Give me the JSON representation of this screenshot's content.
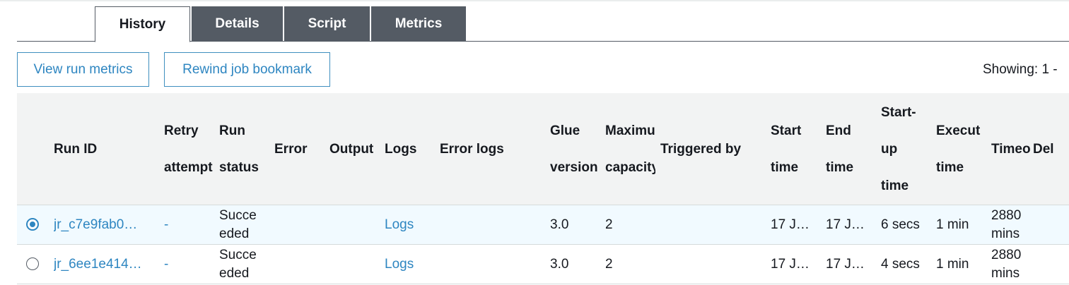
{
  "tabs": [
    {
      "label": "History",
      "active": true
    },
    {
      "label": "Details",
      "active": false
    },
    {
      "label": "Script",
      "active": false
    },
    {
      "label": "Metrics",
      "active": false
    }
  ],
  "actions": {
    "view_run_metrics": "View run metrics",
    "rewind_job_bookmark": "Rewind job bookmark",
    "showing": "Showing: 1 -"
  },
  "columns": {
    "run_id": "Run ID",
    "retry_attempt_1": "Retry",
    "retry_attempt_2": "attempt",
    "run_status_1": "Run",
    "run_status_2": "status",
    "error": "Error",
    "output": "Output",
    "logs": "Logs",
    "error_logs": "Error logs",
    "glue_version_1": "Glue",
    "glue_version_2": "version",
    "maximum_capacity_1": "Maximum",
    "maximum_capacity_2": "capacity",
    "triggered_by": "Triggered by",
    "start_time_1": "Start",
    "start_time_2": "time",
    "end_time_1": "End",
    "end_time_2": "time",
    "startup_time_1": "Start-",
    "startup_time_2": "up",
    "startup_time_3": "time",
    "execution_time_1": "Execut",
    "execution_time_2": "time",
    "timeout": "Timeout",
    "delay": "Del"
  },
  "rows": [
    {
      "selected": true,
      "run_id": "jr_c7e9fab0…",
      "retry_attempt": "-",
      "run_status_1": "Succe",
      "run_status_2": "eded",
      "logs": "Logs",
      "glue_version": "3.0",
      "maximum_capacity": "2",
      "start_time": "17 J…",
      "end_time": "17 J…",
      "startup_time": "6 secs",
      "execution_time": "1 min",
      "timeout_1": "2880",
      "timeout_2": "mins"
    },
    {
      "selected": false,
      "run_id": "jr_6ee1e414…",
      "retry_attempt": "-",
      "run_status_1": "Succe",
      "run_status_2": "eded",
      "logs": "Logs",
      "glue_version": "3.0",
      "maximum_capacity": "2",
      "start_time": "17 J…",
      "end_time": "17 J…",
      "startup_time": "4 secs",
      "execution_time": "1 min",
      "timeout_1": "2880",
      "timeout_2": "mins"
    }
  ]
}
